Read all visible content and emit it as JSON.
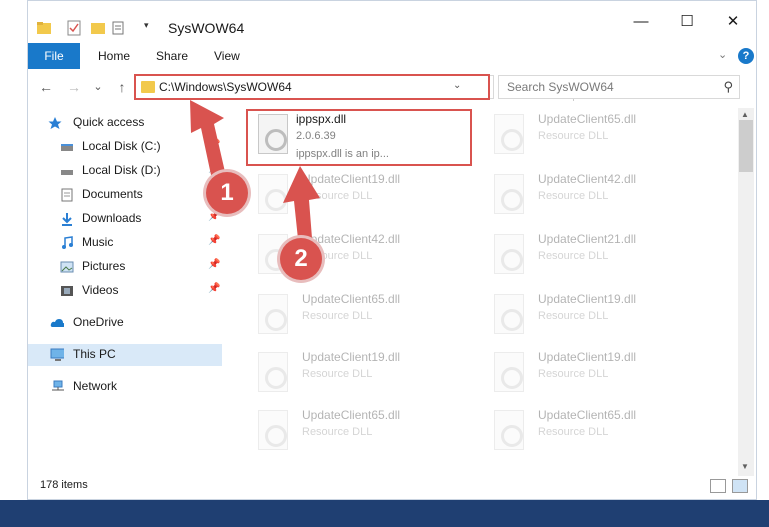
{
  "window": {
    "title": "SysWOW64",
    "minimize": "—",
    "maximize": "☐",
    "close": "✕"
  },
  "ribbon": {
    "tabs": [
      "File",
      "Home",
      "Share",
      "View"
    ]
  },
  "nav": {
    "back": "←",
    "forward": "→",
    "recent": "⌄",
    "up": "↑",
    "address": "C:\\Windows\\SysWOW64",
    "refresh": "↻",
    "search_placeholder": "Search SysWOW64"
  },
  "sidebar": {
    "items": [
      {
        "label": "Quick access",
        "icon": "star-icon",
        "pinned": false
      },
      {
        "label": "Local Disk (C:)",
        "icon": "drive-icon",
        "pinned": true
      },
      {
        "label": "Local Disk (D:)",
        "icon": "drive-icon",
        "pinned": true
      },
      {
        "label": "Documents",
        "icon": "documents-icon",
        "pinned": true
      },
      {
        "label": "Downloads",
        "icon": "download-icon",
        "pinned": true
      },
      {
        "label": "Music",
        "icon": "music-icon",
        "pinned": true
      },
      {
        "label": "Pictures",
        "icon": "pictures-icon",
        "pinned": true
      },
      {
        "label": "Videos",
        "icon": "videos-icon",
        "pinned": true
      },
      {
        "label": "OneDrive",
        "icon": "cloud-icon",
        "pinned": false
      },
      {
        "label": "This PC",
        "icon": "computer-icon",
        "pinned": false,
        "selected": true
      },
      {
        "label": "Network",
        "icon": "network-icon",
        "pinned": false
      }
    ]
  },
  "files": [
    {
      "name": "ippspx.dll",
      "version": "2.0.6.39",
      "desc": "ippspx.dll is an ip..."
    },
    {
      "name": "UpdateClient65.dll",
      "desc": "Resource DLL"
    },
    {
      "name": "UpdateClient19.dll",
      "desc": "Resource DLL"
    },
    {
      "name": "UpdateClient42.dll",
      "desc": "Resource DLL"
    },
    {
      "name": "UpdateClient42.dll",
      "desc": "Resource DLL"
    },
    {
      "name": "UpdateClient21.dll",
      "desc": "Resource DLL"
    },
    {
      "name": "UpdateClient65.dll",
      "desc": "Resource DLL"
    },
    {
      "name": "UpdateClient19.dll",
      "desc": "Resource DLL"
    },
    {
      "name": "UpdateClient19.dll",
      "desc": "Resource DLL"
    },
    {
      "name": "UpdateClient19.dll",
      "desc": "Resource DLL"
    },
    {
      "name": "UpdateClient65.dll",
      "desc": "Resource DLL"
    },
    {
      "name": "UpdateClient65.dll",
      "desc": "Resource DLL"
    }
  ],
  "status": {
    "count": "178 items"
  },
  "callouts": [
    "1",
    "2"
  ],
  "colors": {
    "accent": "#1979ca",
    "highlight": "#d9534f",
    "selected": "#d9e9f8"
  }
}
